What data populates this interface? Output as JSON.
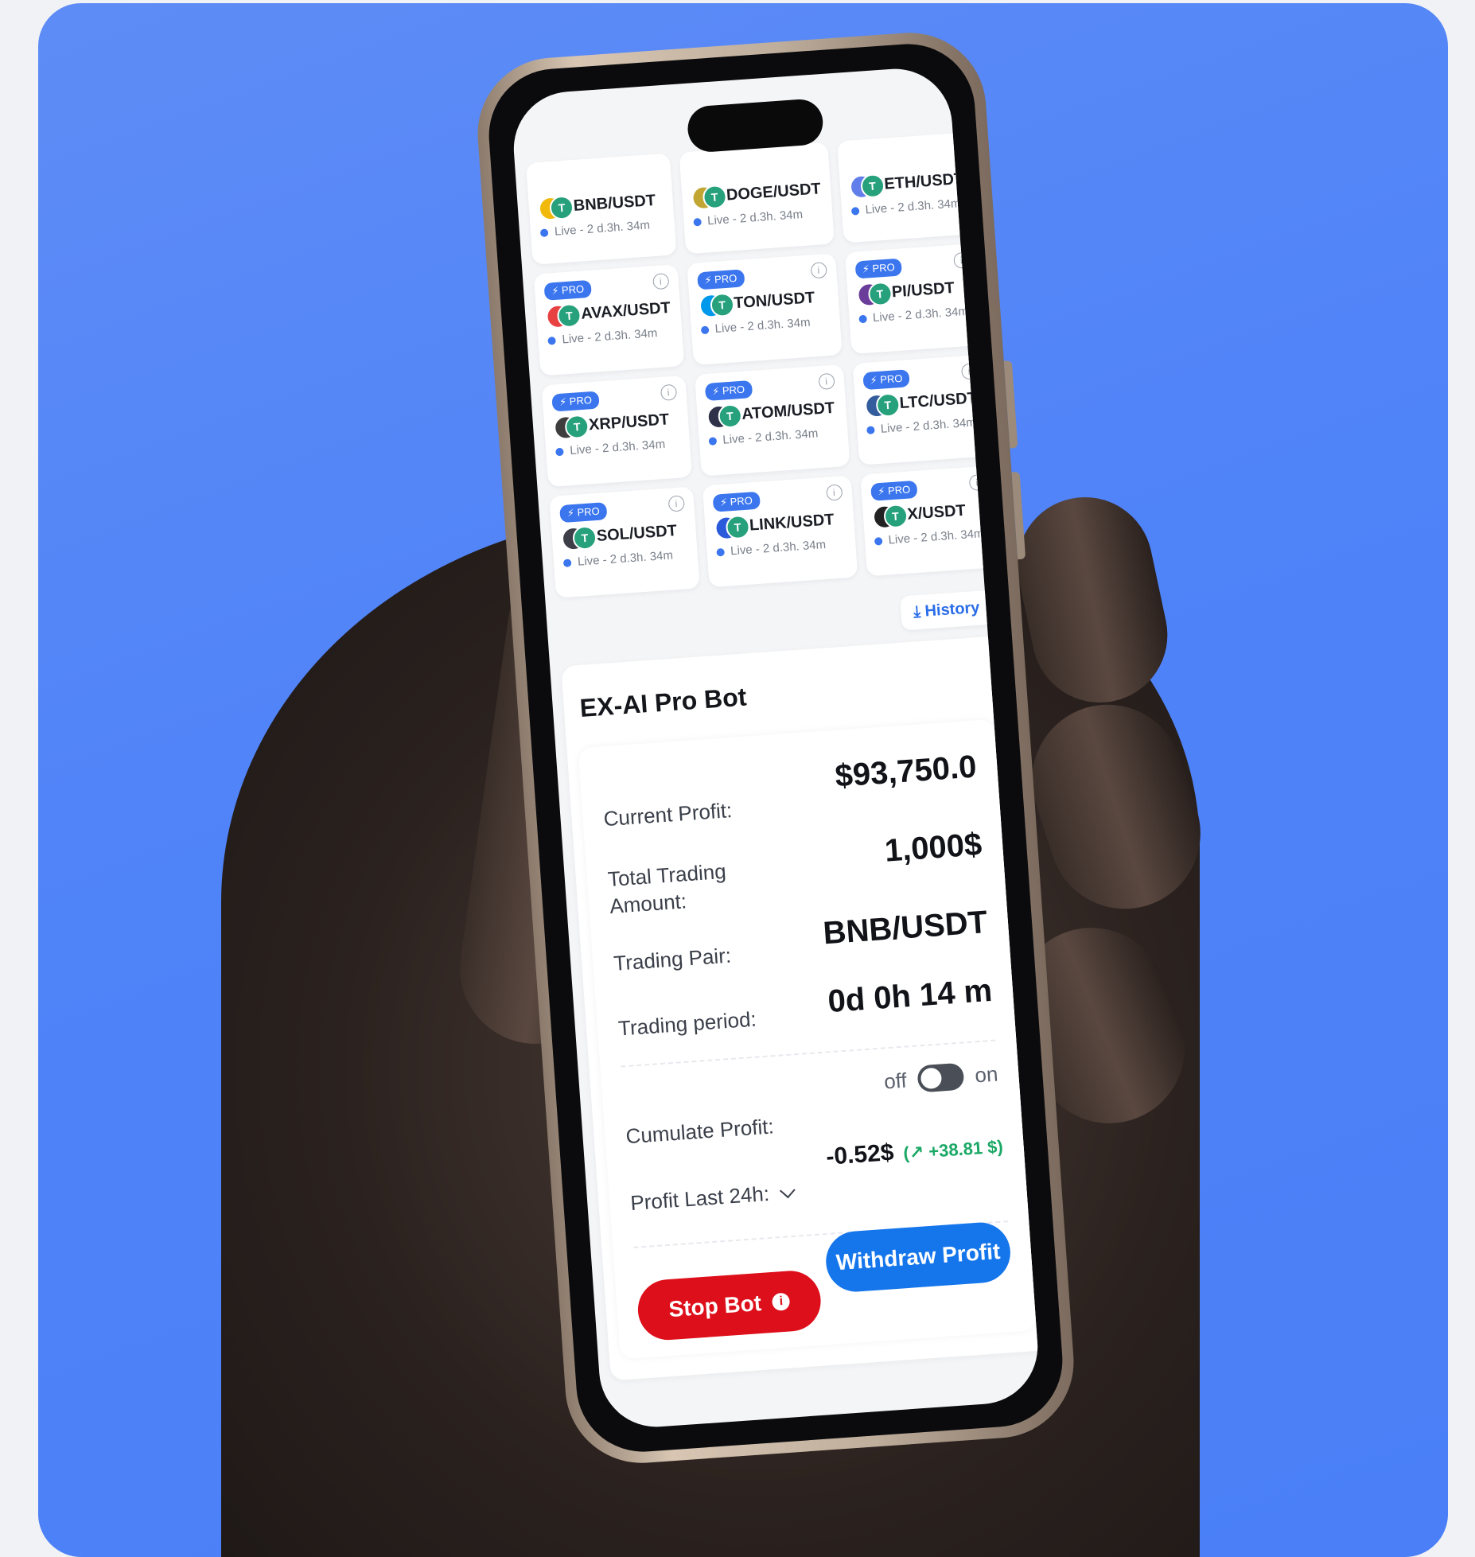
{
  "colors": {
    "background_card": "#4f83f8",
    "accent_blue": "#3b76ee",
    "stop_red": "#dd0f1a",
    "withdraw_blue": "#1576ec",
    "profit_green": "#1aa865"
  },
  "pairs": [
    {
      "name": "BNB/USDT",
      "status": "Live - 2 d.3h. 34m",
      "pro": false,
      "base_color": "#f0b90b"
    },
    {
      "name": "DOGE/USDT",
      "status": "Live - 2 d.3h. 34m",
      "pro": false,
      "base_color": "#c2a633"
    },
    {
      "name": "ETH/USDT",
      "status": "Live - 2 d.3h. 34m",
      "pro": false,
      "base_color": "#627eea"
    },
    {
      "name": "AVAX/USDT",
      "status": "Live - 2 d.3h. 34m",
      "pro": true,
      "base_color": "#e84142"
    },
    {
      "name": "TON/USDT",
      "status": "Live - 2 d.3h. 34m",
      "pro": true,
      "base_color": "#0098ea"
    },
    {
      "name": "PI/USDT",
      "status": "Live - 2 d.3h. 34m",
      "pro": true,
      "base_color": "#6a3d9a"
    },
    {
      "name": "XRP/USDT",
      "status": "Live - 2 d.3h. 34m",
      "pro": true,
      "base_color": "#3d3d3d"
    },
    {
      "name": "ATOM/USDT",
      "status": "Live - 2 d.3h. 34m",
      "pro": true,
      "base_color": "#2e3148"
    },
    {
      "name": "LTC/USDT",
      "status": "Live - 2 d.3h. 34m",
      "pro": true,
      "base_color": "#345d9d"
    },
    {
      "name": "SOL/USDT",
      "status": "Live - 2 d.3h. 34m",
      "pro": true,
      "base_color": "#3e3e48"
    },
    {
      "name": "LINK/USDT",
      "status": "Live - 2 d.3h. 34m",
      "pro": true,
      "base_color": "#2a5ada"
    },
    {
      "name": "X/USDT",
      "status": "Live - 2 d.3h. 34m",
      "pro": true,
      "base_color": "#222222"
    }
  ],
  "pro_label": "PRO",
  "tether_symbol": "T",
  "info_symbol": "i",
  "history_label": "History",
  "bot": {
    "title": "EX-AI Pro Bot",
    "current_profit_label": "Current Profit:",
    "current_profit_value": "$93,750.0",
    "total_trading_label": "Total Trading Amount:",
    "total_trading_value": "1,000$",
    "trading_pair_label": "Trading Pair:",
    "trading_pair_value": "BNB/USDT",
    "trading_period_label": "Trading period:",
    "trading_period_value": "0d 0h 14 m",
    "cumulate_label": "Cumulate Profit:",
    "toggle_off": "off",
    "toggle_on": "on",
    "toggle_state": "off",
    "profit_24h_label": "Profit Last 24h:",
    "profit_24h_value": "-0.52$",
    "profit_24h_change": "(↗ +38.81 $)",
    "stop_label": "Stop Bot",
    "withdraw_label": "Withdraw Profit"
  }
}
